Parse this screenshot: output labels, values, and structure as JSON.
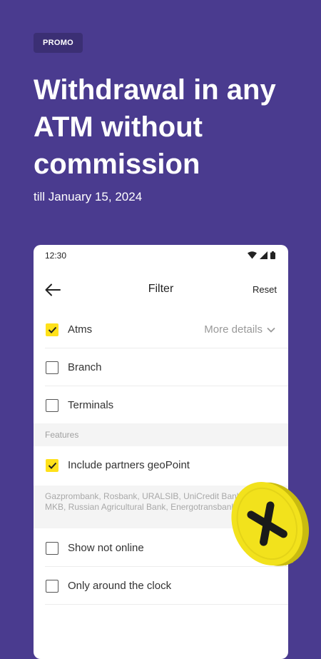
{
  "promo": {
    "badge": "PROMO",
    "headline": "Withdrawal in any ATM without commission",
    "subtitle": "till January 15, 2024"
  },
  "status_bar": {
    "time": "12:30"
  },
  "nav": {
    "title": "Filter",
    "reset_label": "Reset"
  },
  "filters": [
    {
      "label": "Atms",
      "checked": true,
      "more_details": "More details"
    },
    {
      "label": "Branch",
      "checked": false
    },
    {
      "label": "Terminals",
      "checked": false
    }
  ],
  "features": {
    "header": "Features",
    "include_partners": {
      "label": "Include partners geoPoint",
      "checked": true
    },
    "partners_list": "Gazprombank, Rosbank, URALSIB, UniCredit Bank, Otkritie, MKB, Russian Agricultural Bank, Energotransbank",
    "show_not_online": {
      "label": "Show not online",
      "checked": false
    },
    "around_clock": {
      "label": "Only around the clock",
      "checked": false
    }
  },
  "colors": {
    "background": "#4a3b8f",
    "badge": "#3b2f74",
    "checkbox_accent": "#ffe11a",
    "coin": "#f2e21c"
  },
  "icons": [
    "back-arrow-icon",
    "wifi-icon",
    "signal-icon",
    "battery-icon",
    "chevron-down-icon",
    "checkmark-icon",
    "coin-x-icon"
  ]
}
